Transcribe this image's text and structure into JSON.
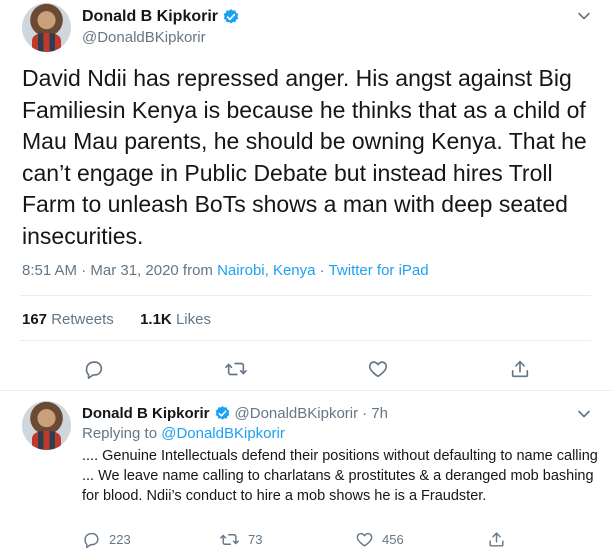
{
  "main_tweet": {
    "author_name": "Donald B Kipkorir",
    "author_handle": "@DonaldBKipkorir",
    "text": "David Ndii has repressed anger. His angst against Big Familiesin Kenya is because he thinks that as a child of Mau Mau parents, he should be owning Kenya. That he can’t engage in Public Debate but instead hires Troll Farm to unleash BoTs shows a man with deep seated insecurities.",
    "timestamp": "8:51 AM · Mar 31, 2020 from",
    "location": "Nairobi, Kenya",
    "separator": "·",
    "source": "Twitter for iPad",
    "retweets_count": "167",
    "retweets_label": "Retweets",
    "likes_count": "1.1K",
    "likes_label": "Likes"
  },
  "reply_tweet": {
    "author_name": "Donald B Kipkorir",
    "author_handle": "@DonaldBKipkorir",
    "time": "· 7h",
    "replying_label": "Replying to",
    "replying_handle": "@DonaldBKipkorir",
    "text": ".... Genuine Intellectuals defend their positions without defaulting to name calling ... We leave name calling to charlatans & prostitutes & a deranged mob bashing for blood. Ndii’s conduct to hire a mob shows he is a Fraudster.",
    "reply_count": "223",
    "retweet_count": "73",
    "like_count": "456"
  },
  "colors": {
    "accent": "#1da1f2",
    "secondary_text": "#657786",
    "divider": "#e6ecf0"
  },
  "icons": [
    "verified-badge-icon",
    "chevron-down-icon",
    "reply-icon",
    "retweet-icon",
    "like-icon",
    "share-icon"
  ]
}
